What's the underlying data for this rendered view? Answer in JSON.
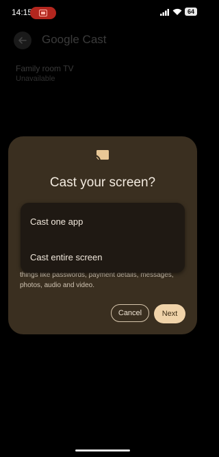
{
  "status_bar": {
    "time": "14:15",
    "battery": "64",
    "icons": [
      "screen-record-icon",
      "wifi-icon",
      "signal-icon",
      "battery-icon"
    ]
  },
  "background_app": {
    "title": "Google Cast",
    "device_name": "Family room TV",
    "device_status": "Unavailable"
  },
  "dialog": {
    "icon": "cast-icon",
    "title": "Cast your screen?",
    "description_visible": "things like passwords, payment details, messages, photos, audio and video.",
    "options": [
      "Cast one app",
      "Cast entire screen"
    ],
    "cancel_label": "Cancel",
    "next_label": "Next"
  },
  "colors": {
    "dialog_bg": "#3a2f20",
    "dropdown_bg": "#1f1913",
    "primary_button": "#f0d3a9",
    "record_pill": "#b3261e"
  }
}
